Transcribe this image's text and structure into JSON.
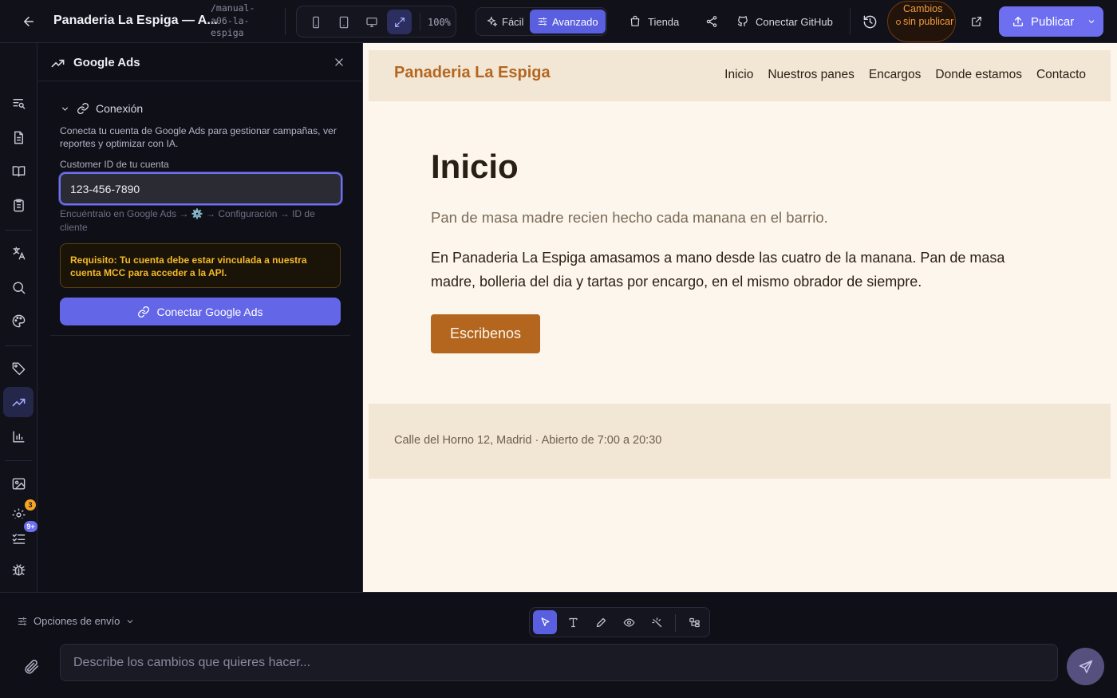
{
  "topbar": {
    "back_icon": "arrow-left-icon",
    "project_title": "Panaderia La Espiga — A...",
    "slug": "/manual-a06-la-espiga",
    "zoom": "100%",
    "modes": [
      {
        "label": "Fácil",
        "icon": "sparkles-icon",
        "active": false
      },
      {
        "label": "Avanzado",
        "icon": "sliders-icon",
        "active": true
      }
    ],
    "store_label": "Tienda",
    "github_label": "Conectar GitHub",
    "unpublished_label": "Cambios sin publicar",
    "publish_label": "Publicar"
  },
  "panel": {
    "title": "Google Ads",
    "section_title": "Conexión",
    "description": "Conecta tu cuenta de Google Ads para gestionar campañas, ver reportes y optimizar con IA.",
    "field_label": "Customer ID de tu cuenta",
    "field_value": "123-456-7890",
    "field_hint": "Encuéntralo en Google Ads → ⚙️ → Configuración → ID de cliente",
    "warning": "Requisito: Tu cuenta debe estar vinculada a nuestra cuenta MCC para acceder a la API.",
    "connect_label": "Conectar Google Ads"
  },
  "rail": {
    "badges": {
      "notifications": "3",
      "tasks": "9+"
    },
    "badge_colors": {
      "notifications": "#f5a623",
      "tasks": "#6d6ef0"
    }
  },
  "preview": {
    "logo": "Panaderia La Espiga",
    "nav": [
      "Inicio",
      "Nuestros panes",
      "Encargos",
      "Donde estamos",
      "Contacto"
    ],
    "title": "Inicio",
    "subtitle": "Pan de masa madre recien hecho cada manana en el barrio.",
    "body": "En Panaderia La Espiga amasamos a mano desde las cuatro de la manana. Pan de masa madre, bolleria del dia y tartas por encargo, en el mismo obrador de siempre.",
    "cta": "Escribenos",
    "footer": "Calle del Horno 12, Madrid · Abierto de 7:00 a 20:30"
  },
  "composer": {
    "send_options_label": "Opciones de envío",
    "placeholder": "Describe los cambios que quieres hacer..."
  },
  "colors": {
    "accent": "#6d6ef0",
    "brand": "#b4661f",
    "warning": "#f5b82a"
  }
}
